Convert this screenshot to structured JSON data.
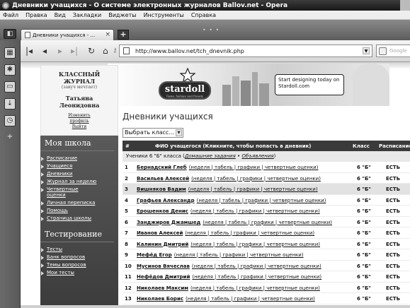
{
  "window": {
    "title": "Дневники учащихся - О системе электронных журналов Ballov.net - Opera"
  },
  "menu": [
    "Файл",
    "Правка",
    "Вид",
    "Закладки",
    "Виджеты",
    "Инструменты",
    "Справка"
  ],
  "tabs": [
    {
      "label": "Дневники учащихся - ...",
      "close": "×"
    }
  ],
  "tab_add": "+",
  "toolbar": {
    "url": "http://www.ballov.net/tch_dnevnik.php",
    "search_placeholder": "Google"
  },
  "icons": {
    "back": "back-arrow-icon",
    "forward": "forward-arrow-icon",
    "rewind": "rewind-icon",
    "fast_forward": "fast-forward-icon",
    "reload": "reload-icon",
    "home": "home-icon",
    "key": "key-icon",
    "speed_dial": "grid-icon",
    "bookmarks": "star-icon",
    "notes": "notes-icon",
    "downloads": "download-icon",
    "history": "history-icon",
    "add_panel": "plus-icon"
  },
  "profile": {
    "title_line1": "КЛАССНЫЙ",
    "title_line2": "ЖУРНАЛ",
    "subtitle": "(завуч мечтает)",
    "name_line1": "Татьяна",
    "name_line2": "Леонидовна",
    "change_line1": "Изменить",
    "change_line2": "профиль",
    "logout": "Выйти"
  },
  "banner": {
    "logo": "stardoll",
    "tagline": "Fame, fashion and friends",
    "bubble": "Start designing today on Stardoll.com"
  },
  "sidebar": {
    "section1": "Моя школа",
    "items1": [
      "Расписание",
      "Учащиеся",
      "Дневники",
      "Журнал за неделю",
      "Четвертные оценки",
      "Личная переписка",
      "Помощь",
      "Страница школы"
    ],
    "section2": "Тестирование",
    "items2": [
      "Тесты",
      "Банк вопросов",
      "Темы вопросов",
      "Мои тесты"
    ]
  },
  "main": {
    "title": "Дневники учащихся",
    "select_value": "Выбрать класс...",
    "table": {
      "headers": {
        "num": "#",
        "name": "ФИО учащегося (Кликните, чтобы попасть в дневник)",
        "class": "Класс",
        "schedule": "Расписание"
      },
      "class_row": {
        "text": "Ученики 6 \"Б\" класса (",
        "link1": "Домашние задания",
        "sep": " • ",
        "link2": "Объявления",
        "close": ")"
      },
      "link_labels": [
        "неделя",
        "табель",
        "графики",
        "четвертные оценки"
      ],
      "rows": [
        {
          "num": "1",
          "name": "Бернадский Глеб",
          "class": "6 \"Б\"",
          "schedule": "ЕСТЬ"
        },
        {
          "num": "2",
          "name": "Васильев Алексей",
          "class": "6 \"Б\"",
          "schedule": "ЕСТЬ"
        },
        {
          "num": "3",
          "name": "Вишняков Вадим",
          "class": "6 \"Б\"",
          "schedule": "ЕСТЬ"
        },
        {
          "num": "4",
          "name": "Графьев Александр",
          "class": "6 \"Б\"",
          "schedule": "ЕСТЬ"
        },
        {
          "num": "5",
          "name": "Ерошенков Денис",
          "class": "6 \"Б\"",
          "schedule": "ЕСТЬ"
        },
        {
          "num": "6",
          "name": "Занджиров Джамшед",
          "class": "6 \"Б\"",
          "schedule": "ЕСТЬ"
        },
        {
          "num": "7",
          "name": "Иванов Алексей",
          "class": "6 \"Б\"",
          "schedule": "ЕСТЬ"
        },
        {
          "num": "8",
          "name": "Калинин Дмитрий",
          "class": "6 \"Б\"",
          "schedule": "ЕСТЬ"
        },
        {
          "num": "9",
          "name": "Мефёд Егор",
          "class": "6 \"Б\"",
          "schedule": "ЕСТЬ"
        },
        {
          "num": "10",
          "name": "Мусинов Вячеслав",
          "class": "6 \"Б\"",
          "schedule": "ЕСТЬ"
        },
        {
          "num": "11",
          "name": "Нефёдов Дмитрий",
          "class": "6 \"Б\"",
          "schedule": "ЕСТЬ"
        },
        {
          "num": "12",
          "name": "Николаев Максим",
          "class": "6 \"Б\"",
          "schedule": "ЕСТЬ"
        },
        {
          "num": "13",
          "name": "Николаев Борис",
          "class": "6 \"Б\"",
          "schedule": "ЕСТЬ"
        }
      ]
    }
  }
}
